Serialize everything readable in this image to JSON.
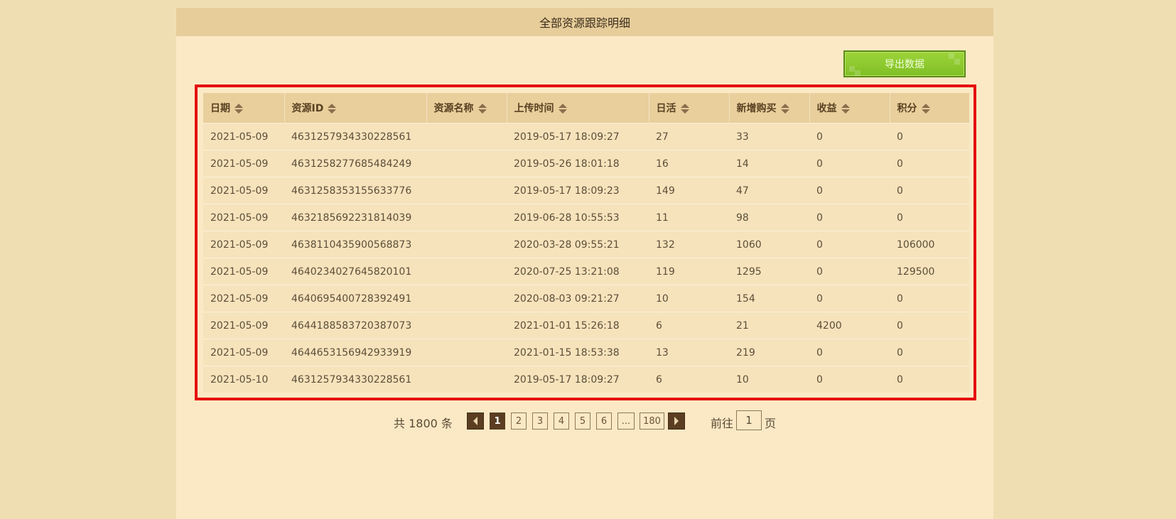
{
  "page": {
    "title": "全部资源跟踪明细"
  },
  "toolbar": {
    "export_label": "导出数据"
  },
  "table": {
    "columns": [
      {
        "label": "日期"
      },
      {
        "label": "资源ID"
      },
      {
        "label": "资源名称"
      },
      {
        "label": "上传时间"
      },
      {
        "label": "日活"
      },
      {
        "label": "新增购买"
      },
      {
        "label": "收益"
      },
      {
        "label": "积分"
      }
    ],
    "rows": [
      [
        "2021-05-09",
        "4631257934330228561",
        "",
        "2019-05-17 18:09:27",
        "27",
        "33",
        "0",
        "0"
      ],
      [
        "2021-05-09",
        "4631258277685484249",
        "",
        "2019-05-26 18:01:18",
        "16",
        "14",
        "0",
        "0"
      ],
      [
        "2021-05-09",
        "4631258353155633776",
        "",
        "2019-05-17 18:09:23",
        "149",
        "47",
        "0",
        "0"
      ],
      [
        "2021-05-09",
        "4632185692231814039",
        "",
        "2019-06-28 10:55:53",
        "11",
        "98",
        "0",
        "0"
      ],
      [
        "2021-05-09",
        "4638110435900568873",
        "",
        "2020-03-28 09:55:21",
        "132",
        "1060",
        "0",
        "106000"
      ],
      [
        "2021-05-09",
        "4640234027645820101",
        "",
        "2020-07-25 13:21:08",
        "119",
        "1295",
        "0",
        "129500"
      ],
      [
        "2021-05-09",
        "4640695400728392491",
        "",
        "2020-08-03 09:21:27",
        "10",
        "154",
        "0",
        "0"
      ],
      [
        "2021-05-09",
        "4644188583720387073",
        "",
        "2021-01-01 15:26:18",
        "6",
        "21",
        "4200",
        "0"
      ],
      [
        "2021-05-09",
        "4644653156942933919",
        "",
        "2021-01-15 18:53:38",
        "13",
        "219",
        "0",
        "0"
      ],
      [
        "2021-05-10",
        "4631257934330228561",
        "",
        "2019-05-17 18:09:27",
        "6",
        "10",
        "0",
        "0"
      ]
    ]
  },
  "pagination": {
    "total_text": "共 1800 条",
    "pages": [
      "1",
      "2",
      "3",
      "4",
      "5",
      "6",
      "...",
      "180"
    ],
    "current": "1",
    "goto_prefix": "前往",
    "goto_value": "1",
    "goto_suffix": "页"
  },
  "colors": {
    "background": "#f0deb3",
    "panel": "#fbe9c5",
    "header_bar": "#e6cd9a",
    "highlight_border": "#e60f0f",
    "export_button": "#8cc63f",
    "active_page": "#5b3e22"
  }
}
